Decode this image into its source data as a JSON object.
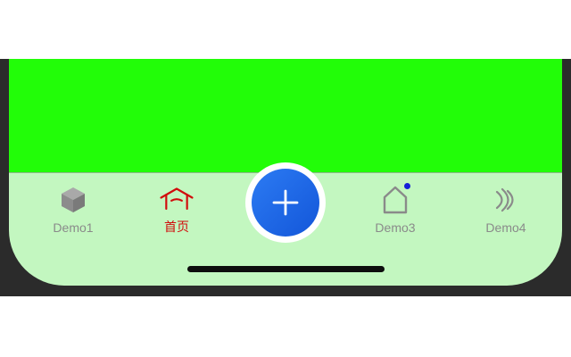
{
  "tabbar": {
    "tabs": [
      {
        "label": "Demo1",
        "icon": "cube-icon",
        "active": false
      },
      {
        "label": "首页",
        "icon": "house-roof-icon",
        "active": true
      },
      {
        "label": "Demo3",
        "icon": "house-outline-icon",
        "active": false,
        "badge": true
      },
      {
        "label": "Demo4",
        "icon": "signal-waves-icon",
        "active": false
      }
    ],
    "center_button": {
      "icon": "plus-icon"
    }
  },
  "colors": {
    "content_background": "#22fd08",
    "tabbar_background": "#c3f7c0",
    "active_tab": "#d10c0c",
    "inactive_tab": "#8a8a8a",
    "center_button": "#1f6ae6",
    "badge": "#1420d8"
  }
}
